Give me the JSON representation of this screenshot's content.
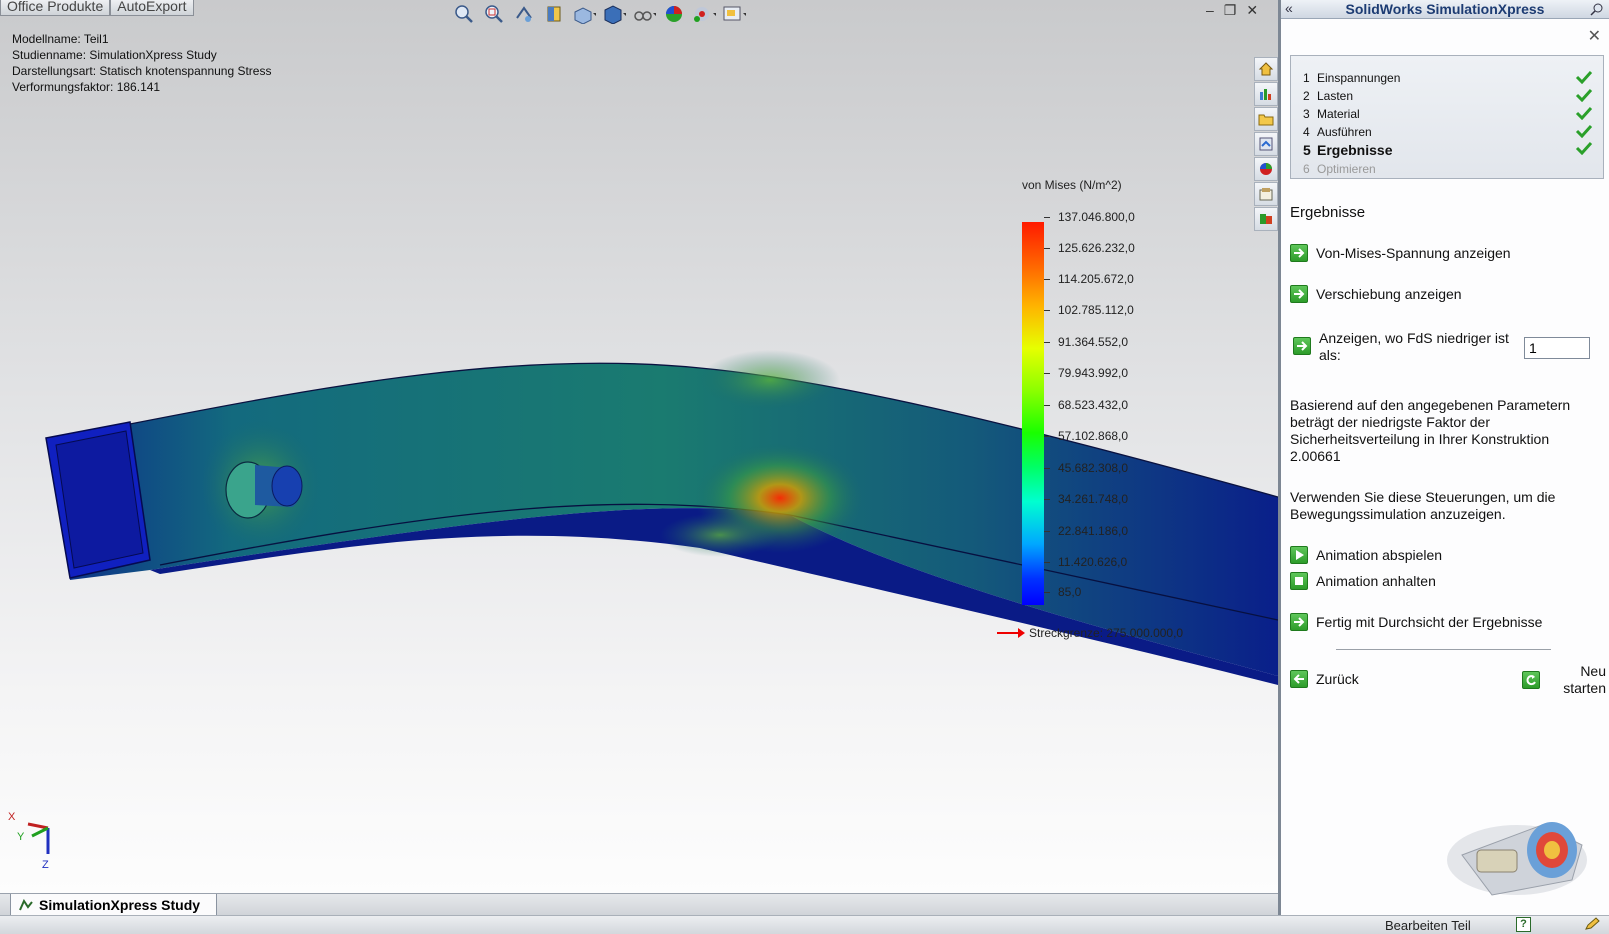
{
  "office_tabs": [
    "Office Produkte",
    "AutoExport"
  ],
  "model_info": [
    "Modellname: Teil1",
    "Studienname: SimulationXpress Study",
    "Darstellungsart: Statisch knotenspannung Stress",
    "Verformungsfaktor: 186.141"
  ],
  "toolbar_icons": [
    "zoom-to-fit-icon",
    "zoom-area-icon",
    "previous-view-icon",
    "section-view-icon",
    "view-orientation-icon",
    "display-style-icon",
    "hide-show-items-icon",
    "edit-appearance-icon",
    "apply-scene-icon",
    "view-settings-icon"
  ],
  "right_tools": [
    "home-icon",
    "resources-icon",
    "open-folder-icon",
    "view-palette-icon",
    "appearances-icon",
    "custom-properties-icon",
    "simulationxpress-icon"
  ],
  "legend": {
    "title": "von Mises (N/m^2)",
    "labels": [
      "137.046.800,0",
      "125.626.232,0",
      "114.205.672,0",
      "102.785.112,0",
      "91.364.552,0",
      "79.943.992,0",
      "68.523.432,0",
      "57.102.868,0",
      "45.682.308,0",
      "34.261.748,0",
      "22.841.186,0",
      "11.420.626,0",
      "85,0"
    ],
    "yield": "Streckgrenze: 275.000.000,0"
  },
  "triad": {
    "x": "X",
    "y": "Y",
    "z": "Z"
  },
  "study_tab": "SimulationXpress Study",
  "panel": {
    "title": "SolidWorks SimulationXpress",
    "collapse": "«",
    "close": "✕",
    "steps": [
      {
        "num": "1",
        "label": "Einspannungen",
        "done": true
      },
      {
        "num": "2",
        "label": "Lasten",
        "done": true
      },
      {
        "num": "3",
        "label": "Material",
        "done": true
      },
      {
        "num": "4",
        "label": "Ausführen",
        "done": true
      },
      {
        "num": "5",
        "label": "Ergebnisse",
        "done": true
      },
      {
        "num": "6",
        "label": "Optimieren",
        "done": false
      }
    ],
    "section_title": "Ergebnisse",
    "link_vonmises": "Von-Mises-Spannung anzeigen",
    "link_displacement": "Verschiebung anzeigen",
    "link_fos": "Anzeigen, wo FdS niedriger ist als:",
    "fos_value": "1",
    "result_text": "Basierend auf den angegebenen Parametern beträgt der niedrigste Faktor der Sicherheitsverteilung in Ihrer Konstruktion 2.00661",
    "animation_text": "Verwenden Sie diese Steuerungen, um die Bewegungssimulation anzuzeigen.",
    "link_play": "Animation abspielen",
    "link_stop": "Animation anhalten",
    "link_done": "Fertig mit Durchsicht der Ergebnisse",
    "link_back": "Zurück",
    "link_restart": "Neu starten"
  },
  "status": {
    "text": "Bearbeiten Teil",
    "help": "?"
  }
}
